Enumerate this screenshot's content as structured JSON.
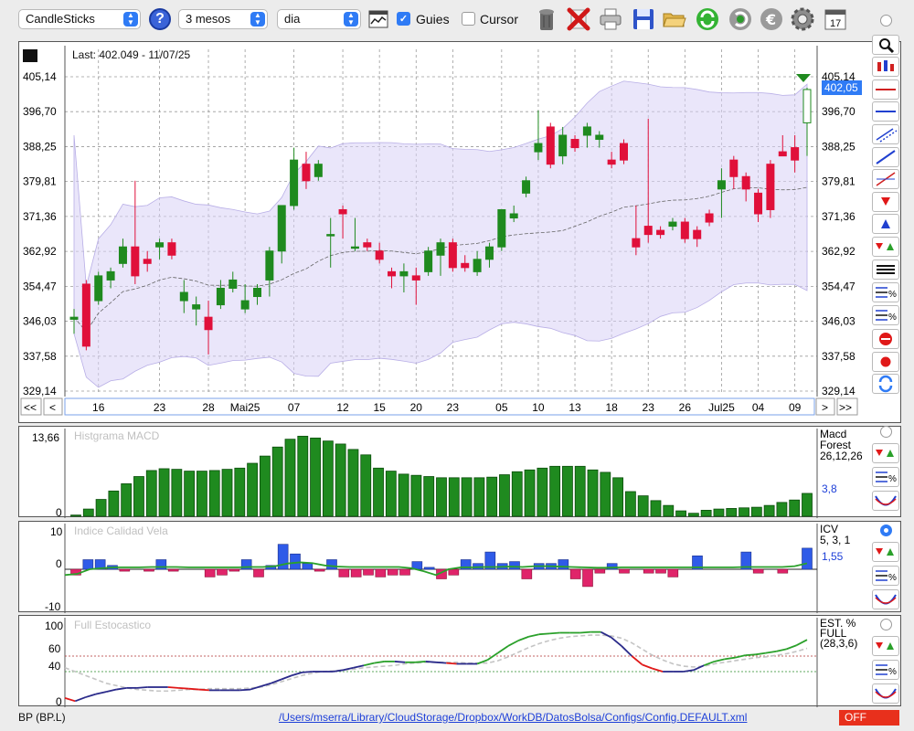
{
  "toolbar": {
    "chart_type": "CandleSticks",
    "period": "3 mesos",
    "interval": "dia",
    "guides_label": "Guies",
    "guides_checked": true,
    "cursor_label": "Cursor",
    "cursor_checked": false,
    "icons": [
      "trash-icon",
      "delete-icon",
      "print-icon",
      "save-icon",
      "open-folder-icon",
      "refresh-icon",
      "sync-icon",
      "currency-icon",
      "gear-icon",
      "calendar-icon"
    ],
    "calendar_day": "17"
  },
  "price_panel": {
    "last_label": "Last: 402.049 - 11/07/25",
    "current_price_tag": "402,05",
    "y_labels": [
      "405,14",
      "396,70",
      "388,25",
      "379,81",
      "371,36",
      "362,92",
      "354,47",
      "346,03",
      "337,58",
      "329,14"
    ],
    "x_labels": [
      "16",
      "23",
      "28",
      "Mai25",
      "07",
      "12",
      "15",
      "20",
      "23",
      "05",
      "10",
      "13",
      "18",
      "23",
      "26",
      "Jul25",
      "04",
      "09"
    ],
    "nav_left": [
      "<<",
      "<"
    ],
    "nav_right": [
      ">",
      ">>"
    ]
  },
  "macd_panel": {
    "title": "Histgrama MACD",
    "y_top": "13,66",
    "y_bottom": "0",
    "legend": [
      "Macd",
      "Forest",
      "26,12,26"
    ],
    "value": "3,8"
  },
  "icv_panel": {
    "title": "Indice Calidad Vela",
    "y_labels": [
      "10",
      "0",
      "-10"
    ],
    "legend": [
      "ICV",
      "5, 3, 1"
    ],
    "value": "1,55"
  },
  "stoch_panel": {
    "title": "Full Estocastico",
    "y_labels": [
      "100",
      "60",
      "40",
      "0"
    ],
    "legend": [
      "EST. %",
      "FULL",
      "(28,3,6)"
    ]
  },
  "status": {
    "ticker": "BP (BP.L)",
    "path": "/Users/mserra/Library/CloudStorage/Dropbox/WorkDB/DatosBolsa/Configs/Config.DEFAULT.xml",
    "state": "OFF"
  },
  "colors": {
    "up": "#1f8a1f",
    "down": "#e0103a",
    "accent": "#2f7bf5",
    "band": "#d9d2f5"
  },
  "chart_data": [
    {
      "type": "candlestick",
      "y_range": [
        329.14,
        405.14
      ],
      "candles": [
        [
          346.5,
          343,
          349,
          347
        ],
        [
          355,
          339,
          356,
          340
        ],
        [
          351,
          350,
          358,
          357
        ],
        [
          356,
          354,
          359,
          358
        ],
        [
          360,
          359,
          366,
          364
        ],
        [
          364,
          355,
          380,
          357
        ],
        [
          361,
          358,
          363,
          360
        ],
        [
          364,
          361,
          366,
          365
        ],
        [
          365,
          361,
          366,
          362
        ],
        [
          351,
          348,
          356,
          353
        ],
        [
          349,
          345,
          352,
          350
        ],
        [
          347,
          338,
          351,
          344
        ],
        [
          350,
          349,
          356,
          354
        ],
        [
          354,
          353,
          358,
          356
        ],
        [
          349,
          348,
          355,
          351
        ],
        [
          352,
          350,
          355,
          354
        ],
        [
          356,
          352,
          364,
          363
        ],
        [
          363,
          360,
          374,
          374
        ],
        [
          374,
          373,
          388,
          385
        ],
        [
          384,
          378,
          387,
          380
        ],
        [
          381,
          380,
          385,
          384
        ],
        [
          367,
          359,
          371,
          367
        ],
        [
          373,
          366,
          374,
          372
        ],
        [
          364,
          363,
          371,
          364
        ],
        [
          365,
          363,
          366,
          364
        ],
        [
          363,
          360,
          365,
          361
        ],
        [
          358,
          354,
          359,
          357
        ],
        [
          357,
          353,
          360,
          358
        ],
        [
          357,
          350,
          359,
          356
        ],
        [
          358,
          357,
          364,
          363
        ],
        [
          362,
          357,
          366,
          365
        ],
        [
          365,
          358,
          366,
          359
        ],
        [
          360,
          358,
          362,
          359
        ],
        [
          358,
          357,
          363,
          361
        ],
        [
          361,
          359,
          365,
          364
        ],
        [
          364,
          363,
          373,
          373
        ],
        [
          371,
          370,
          374,
          372
        ],
        [
          377,
          376,
          381,
          380
        ],
        [
          387,
          385,
          397,
          389
        ],
        [
          393,
          383,
          394,
          384
        ],
        [
          386,
          384,
          393,
          391
        ],
        [
          390,
          387,
          391,
          388
        ],
        [
          391,
          388,
          394,
          393
        ],
        [
          390,
          388,
          392,
          391
        ],
        [
          385,
          383,
          387,
          384
        ],
        [
          389,
          384,
          390,
          385
        ],
        [
          366,
          362,
          374,
          364
        ],
        [
          369,
          365,
          395,
          367
        ],
        [
          368,
          366,
          369,
          367
        ],
        [
          369,
          368,
          371,
          370
        ],
        [
          370,
          365,
          371,
          366
        ],
        [
          368,
          364,
          369,
          366
        ],
        [
          372,
          369,
          373,
          370
        ],
        [
          378,
          371,
          383,
          380
        ],
        [
          385,
          378,
          386,
          381
        ],
        [
          381,
          375,
          382,
          378
        ],
        [
          377,
          370,
          378,
          372
        ],
        [
          384,
          371,
          385,
          373
        ],
        [
          387,
          386,
          391,
          386
        ],
        [
          388,
          382,
          391,
          385
        ],
        [
          394,
          386,
          402.5,
          402.05
        ]
      ]
    },
    {
      "type": "bar",
      "name": "Histgrama MACD",
      "values": [
        0.2,
        1.2,
        2.8,
        4.2,
        5.4,
        6.6,
        7.6,
        7.9,
        7.8,
        7.5,
        7.5,
        7.6,
        7.8,
        8.0,
        8.8,
        10.0,
        11.5,
        12.8,
        13.3,
        13.0,
        12.5,
        12.0,
        11.1,
        10.2,
        8.0,
        7.5,
        7.0,
        6.8,
        6.6,
        6.4,
        6.4,
        6.4,
        6.4,
        6.5,
        6.9,
        7.4,
        7.7,
        8.0,
        8.3,
        8.3,
        8.3,
        7.7,
        7.3,
        6.4,
        4.1,
        3.4,
        2.6,
        1.8,
        0.9,
        0.5,
        1.0,
        1.2,
        1.3,
        1.4,
        1.5,
        1.8,
        2.3,
        2.7,
        3.8
      ],
      "ylim": [
        0,
        13.66
      ]
    },
    {
      "type": "bar",
      "name": "Indice Calidad Vela",
      "values": [
        -1.5,
        2.5,
        2.5,
        1.0,
        -0.5,
        0,
        -0.5,
        2.5,
        -0.5,
        0,
        0,
        -2,
        -1.5,
        -0.5,
        2.5,
        -2,
        1.0,
        6.5,
        4,
        1.5,
        -0.5,
        2.5,
        -2,
        -2,
        -1.5,
        -2,
        -1.5,
        -1.5,
        2,
        0.5,
        -2.5,
        -1.5,
        2.5,
        1.5,
        4.5,
        1.5,
        2,
        -2.5,
        1.5,
        1.5,
        2.5,
        -2.5,
        -4.5,
        -1,
        1.5,
        -1,
        0,
        -1,
        -1,
        -2,
        0,
        3.5,
        0,
        0,
        0,
        4.5,
        -1,
        0,
        -1,
        0,
        5.5
      ],
      "line": [
        -1.5,
        -1.2,
        0,
        0.3,
        0.5,
        0.5,
        0.5,
        0.6,
        0.6,
        0.6,
        0.5,
        0.5,
        0.5,
        0.5,
        0.5,
        0.6,
        0.6,
        0.8,
        1.5,
        1.8,
        1.6,
        1.0,
        0.7,
        0.6,
        0.6,
        0.6,
        0.6,
        0.6,
        0.3,
        -0.5,
        -1.5,
        0,
        0.5,
        0.5,
        0.6,
        0.6,
        0.7,
        0.6,
        0.8,
        0.8,
        0.7,
        0.6,
        0.5,
        0.4,
        0.4,
        0.5,
        0.5,
        0.5,
        0.5,
        0.5,
        0.5,
        0.5,
        0.5,
        0.5,
        0.5,
        0.6,
        0.6,
        0.6,
        0.6,
        0.8,
        1.55
      ],
      "ylim": [
        -10,
        10
      ]
    },
    {
      "type": "line",
      "name": "Full Estocastico",
      "k": [
        6,
        2,
        7,
        11,
        14,
        17,
        19,
        19,
        20,
        20,
        20,
        19,
        18,
        17,
        16,
        16,
        16,
        16,
        17,
        21,
        25,
        30,
        35,
        39,
        40,
        40,
        40,
        42,
        45,
        48,
        51,
        53,
        53,
        52,
        52,
        53,
        52,
        51,
        50,
        50,
        50,
        55,
        64,
        73,
        80,
        85,
        88,
        89,
        90,
        90,
        90,
        91,
        91,
        84,
        73,
        60,
        49,
        44,
        40,
        40,
        40,
        42,
        48,
        53,
        56,
        58,
        61,
        62,
        64,
        66,
        69,
        74,
        81
      ],
      "d": [
        45,
        40,
        35,
        30,
        25,
        22,
        19,
        17,
        16,
        15,
        15,
        16,
        17,
        17,
        18,
        18,
        18,
        18,
        19,
        20,
        23,
        27,
        31,
        35,
        38,
        40,
        41,
        42,
        43,
        45,
        46,
        47,
        48,
        50,
        51,
        52,
        52,
        52,
        52,
        51,
        51,
        51,
        54,
        59,
        65,
        71,
        76,
        80,
        83,
        85,
        86,
        87,
        87,
        86,
        83,
        77,
        69,
        61,
        55,
        50,
        47,
        46,
        47,
        50,
        52,
        54,
        56,
        58,
        59,
        61,
        63,
        66,
        70
      ],
      "ylim": [
        0,
        100
      ]
    }
  ]
}
